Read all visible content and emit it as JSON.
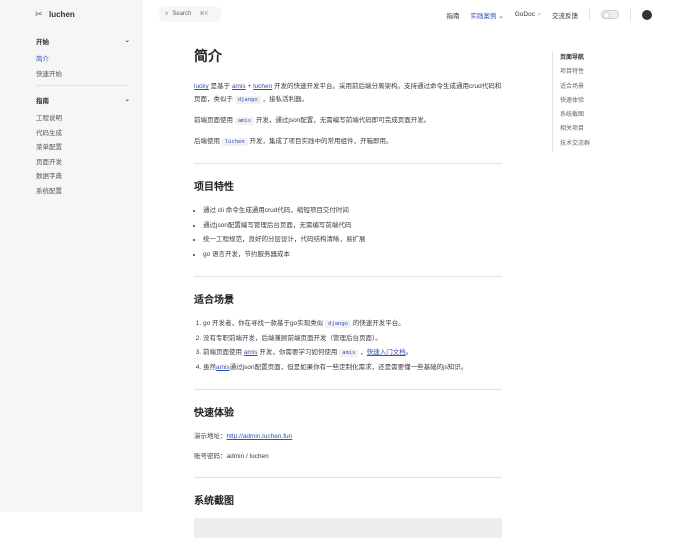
{
  "logo": {
    "text": "luchen"
  },
  "sidebar": {
    "groups": [
      {
        "title": "开始",
        "items": [
          "简介",
          "快速开始"
        ]
      },
      {
        "title": "指南",
        "items": [
          "工程说明",
          "代码生成",
          "菜单配置",
          "页面开发",
          "数据字典",
          "系统配置"
        ]
      }
    ]
  },
  "search": {
    "label": "Search",
    "shortcut": "⌘K"
  },
  "nav": {
    "items": [
      "指南",
      "实践案例",
      "GoDoc",
      "交流反馈"
    ]
  },
  "toc": {
    "title": "页面导航",
    "items": [
      "项目特性",
      "适合场景",
      "快速体验",
      "系统截图",
      "相关项目",
      "技术交流群"
    ]
  },
  "content": {
    "title": "简介",
    "intro": {
      "lucky": "lucky",
      "t1": " 是基于 ",
      "amis": "amis",
      "plus": " + ",
      "luchen": "luchen",
      "t2": " 开发的快速开发平台。采用前后端分离架构。支持通过命令生成通用crud代码和页面，类似于 ",
      "django": "django",
      "t3": " ，接私活利器。"
    },
    "p2": {
      "t1": "前端页面使用 ",
      "code": "amis",
      "t2": " 开发，通过json配置，无需编写前端代码即可完成页面开发。"
    },
    "p3": {
      "t1": "后端使用 ",
      "code": "luchen",
      "t2": " 开发，集成了项目实践中的常用组件，开箱即用。"
    },
    "features": {
      "title": "项目特性",
      "items": [
        "通过 cli 命令生成通用crud代码，缩短项目交付时间",
        "通过json配置编写管理后台页面，无需编写前端代码",
        "统一工程规范，良好的分层设计，代码结构清晰，易扩展",
        "go 语言开发，节约服务器成本"
      ]
    },
    "scenarios": {
      "title": "适合场景",
      "i1": {
        "t1": "go 开发者，你在寻找一款基于go实现类似 ",
        "code": "django",
        "t2": " 的快速开发平台。"
      },
      "i2": "没有专职前端开发，后端兼顾前端页面开发（管理后台页面）。",
      "i3": {
        "t1": "前端页面使用 ",
        "link": "amis",
        "t2": " 开发，你需要学习如何使用 ",
        "code": "amis",
        "t3": " ，",
        "link2": "快速入门文档",
        "t4": "。"
      },
      "i4": {
        "t1": "虽然",
        "link": "amis",
        "t2": "通过json配置页面，但是如果你有一些定制化需求，还是需要懂一些基础的js知识。"
      }
    },
    "demo": {
      "title": "快速体验",
      "addr_label": "演示地址：",
      "addr": "http://admin.luchen.fun",
      "account": "账号密码：admin / luchen"
    },
    "screens": {
      "title": "系统截图"
    }
  }
}
